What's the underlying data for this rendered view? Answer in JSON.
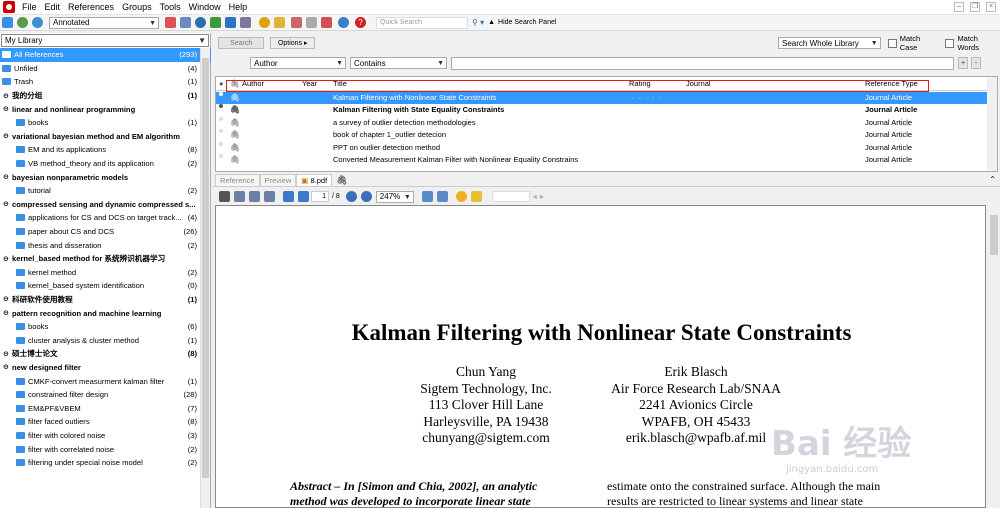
{
  "menu": [
    "File",
    "Edit",
    "References",
    "Groups",
    "Tools",
    "Window",
    "Help"
  ],
  "toolbar": {
    "style": "Annotated",
    "quick_search_placeholder": "Quick Search",
    "hide_panel": "Hide Search Panel"
  },
  "sidebar": {
    "title": "My Library",
    "items": [
      {
        "label": "All References",
        "count": "(293)",
        "type": "sel"
      },
      {
        "label": "Unfiled",
        "count": "(4)",
        "type": "special"
      },
      {
        "label": "Trash",
        "count": "(1)",
        "type": "special"
      },
      {
        "label": "我的分组",
        "count": "(1)",
        "type": "group"
      },
      {
        "label": "linear and nonlinear programming",
        "count": "",
        "type": "group"
      },
      {
        "label": "books",
        "count": "(1)",
        "type": "folder"
      },
      {
        "label": "variational bayesian method and EM algorithm",
        "count": "",
        "type": "group"
      },
      {
        "label": "EM and its applications",
        "count": "(8)",
        "type": "folder"
      },
      {
        "label": "VB method_theory and its application",
        "count": "(2)",
        "type": "folder"
      },
      {
        "label": "bayesian nonparametric models",
        "count": "",
        "type": "group"
      },
      {
        "label": "tutorial",
        "count": "(2)",
        "type": "folder"
      },
      {
        "label": "compressed sensing and dynamic compressed s...",
        "count": "",
        "type": "group"
      },
      {
        "label": "applications for CS and DCS on target track...",
        "count": "(4)",
        "type": "folder"
      },
      {
        "label": "paper about CS and DCS",
        "count": "(26)",
        "type": "folder"
      },
      {
        "label": "thesis and disseration",
        "count": "(2)",
        "type": "folder"
      },
      {
        "label": "kernel_based method for 系统辨识机器学习",
        "count": "",
        "type": "group"
      },
      {
        "label": "kernel method",
        "count": "(2)",
        "type": "folder"
      },
      {
        "label": "kernel_based system identification",
        "count": "(0)",
        "type": "folder"
      },
      {
        "label": "科研软件使用教程",
        "count": "(1)",
        "type": "group"
      },
      {
        "label": "pattern recognition and machine learning",
        "count": "",
        "type": "group"
      },
      {
        "label": "books",
        "count": "(6)",
        "type": "folder"
      },
      {
        "label": "cluster analysis & cluster method",
        "count": "(1)",
        "type": "folder"
      },
      {
        "label": "硕士博士论文",
        "count": "(8)",
        "type": "group"
      },
      {
        "label": "new designed filter",
        "count": "",
        "type": "group"
      },
      {
        "label": "CMKF-convert measurment kalman filter",
        "count": "(1)",
        "type": "folder"
      },
      {
        "label": "constrained filter design",
        "count": "(28)",
        "type": "folder"
      },
      {
        "label": "EM&PF&VBEM",
        "count": "(7)",
        "type": "folder"
      },
      {
        "label": "filter faced outliers",
        "count": "(8)",
        "type": "folder"
      },
      {
        "label": "filter with colored noise",
        "count": "(3)",
        "type": "folder"
      },
      {
        "label": "filter with correlated noise",
        "count": "(2)",
        "type": "folder"
      },
      {
        "label": "filtering under special noise model",
        "count": "(2)",
        "type": "folder"
      }
    ]
  },
  "search": {
    "search_btn": "Search",
    "options_btn": "Options",
    "scope": "Search Whole Library",
    "match_case": "Match Case",
    "match_words": "Match Words",
    "field": "Author",
    "operator": "Contains",
    "plus": "+",
    "minus": "-"
  },
  "columns": {
    "author": "Author",
    "year": "Year",
    "title": "Title",
    "rating": "Rating",
    "journal": "Journal",
    "reftype": "Reference Type"
  },
  "references": [
    {
      "title": "Kalman Filtering with Nonlinear State Constraints",
      "rating": "· · · · ·",
      "type": "Journal Article",
      "style": "sel"
    },
    {
      "title": "Kalman Filtering with State Equality Constraints",
      "rating": "",
      "type": "Journal Article",
      "style": "bold"
    },
    {
      "title": "a survey of outlier detection methodologies",
      "rating": "",
      "type": "Journal Article",
      "style": ""
    },
    {
      "title": "book of chapter 1_outlier detecion",
      "rating": "",
      "type": "Journal Article",
      "style": ""
    },
    {
      "title": "PPT on outlier detection method",
      "rating": "",
      "type": "Journal Article",
      "style": ""
    },
    {
      "title": "Converted Measurement Kalman Filter with Nonlinear Equality Constrains",
      "rating": "",
      "type": "Journal Article",
      "style": ""
    }
  ],
  "tabs": {
    "reference": "Reference",
    "preview": "Preview",
    "pdf": "8.pdf"
  },
  "pdf_toolbar": {
    "page": "1",
    "total": "/ 8",
    "zoom": "247%"
  },
  "paper": {
    "title": "Kalman Filtering with Nonlinear State Constraints",
    "author1": [
      "Chun Yang",
      "Sigtem Technology, Inc.",
      "113 Clover Hill Lane",
      "Harleysville, PA 19438",
      "chunyang@sigtem.com"
    ],
    "author2": [
      "Erik Blasch",
      "Air Force Research Lab/SNAA",
      "2241 Avionics Circle",
      "WPAFB, OH 45433",
      "erik.blasch@wpafb.af.mil"
    ],
    "abstract_left1": "Abstract – In [Simon and Chia, 2002], an analytic",
    "abstract_left2": "method was developed to incorporate linear state",
    "abstract_right1": "estimate onto the constrained surface. Although the main",
    "abstract_right2": "results are restricted to linear systems and linear state"
  },
  "watermark": {
    "brand": "Bai 经验",
    "url": "jingyan.baidu.com"
  },
  "colors": {
    "selection": "#3399ff",
    "highlight_box": "#e21b1b",
    "folder": "#3a8ee6"
  }
}
